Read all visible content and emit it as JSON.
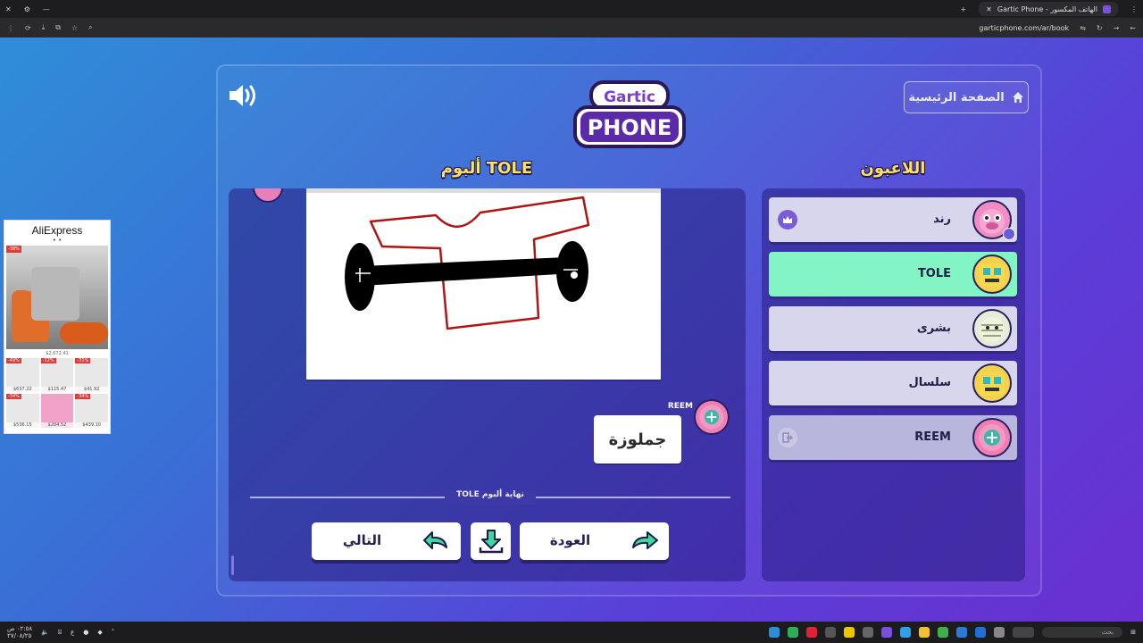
{
  "browser": {
    "tab_title": "Gartic Phone - الهاتف المكسور",
    "url": "garticphone.com/ar/book"
  },
  "ad": {
    "brand": "AliExpress",
    "dots": "• •",
    "hero_discount": "-38%",
    "hero_price": "$2,672.41",
    "items": [
      {
        "discount": "-49%",
        "price": "$637.22"
      },
      {
        "discount": "-12%",
        "price": "$115.47"
      },
      {
        "discount": "-31%",
        "price": "$41.92"
      },
      {
        "discount": "-34%",
        "price": "$536.15"
      },
      {
        "discount": "",
        "price": "$204.52"
      },
      {
        "discount": "-34%",
        "price": "$439.10"
      }
    ]
  },
  "game": {
    "logo_top": "Gartic",
    "logo_bottom": "PHONE",
    "home_label": "الصفحة الرئيسية",
    "players_title": "اللاعبون",
    "album_title": "ألبوم TOLE",
    "players": [
      {
        "name": "رند",
        "badge": "crown-icon"
      },
      {
        "name": "TOLE",
        "badge": ""
      },
      {
        "name": "بشرى",
        "badge": ""
      },
      {
        "name": "سلسال",
        "badge": ""
      },
      {
        "name": "REEM",
        "badge": "exit-icon"
      }
    ],
    "answer_author": "REEM",
    "answer_text": "جملوزة",
    "end_label": "نهاية ألبوم TOLE",
    "next_label": "التالي",
    "back_label": "العودة"
  },
  "taskbar": {
    "search_placeholder": "بحث",
    "time": "٠٢:٥٨ ص",
    "date": "٢٧/٠٨/٢٥"
  },
  "colors": {
    "accent_yellow": "#ffe066",
    "active_player": "#83f5c4",
    "panel": "#261e82"
  }
}
